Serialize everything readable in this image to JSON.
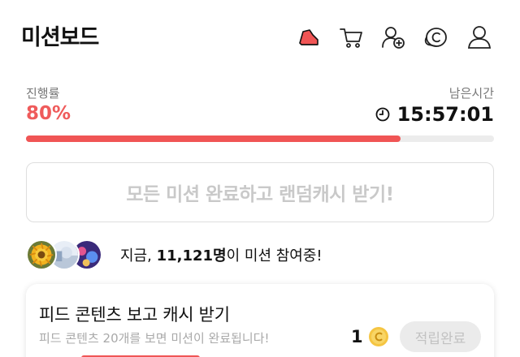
{
  "header": {
    "title": "미션보드",
    "icons": [
      "sneaker-icon",
      "cart-icon",
      "add-user-icon",
      "coin-icon",
      "profile-icon"
    ]
  },
  "progress": {
    "label": "진행률",
    "value_text": "80%",
    "fraction": 0.8,
    "remaining_label": "남은시간",
    "remaining_time": "15:57:01"
  },
  "reward_banner": {
    "label": "모든 미션 완료하고 랜덤캐시 받기!"
  },
  "participants": {
    "prefix": "지금, ",
    "count": "11,121명",
    "suffix": "이 미션 참여중!"
  },
  "mission": {
    "title": "피드 콘텐츠 보고 캐시 받기",
    "description": "피드 콘텐츠 20개를 보면 미션이 완료됩니다!",
    "reward_amount": "1",
    "button_label": "적립완료"
  },
  "colors": {
    "accent": "#f05555",
    "muted": "#c9c9c9"
  }
}
